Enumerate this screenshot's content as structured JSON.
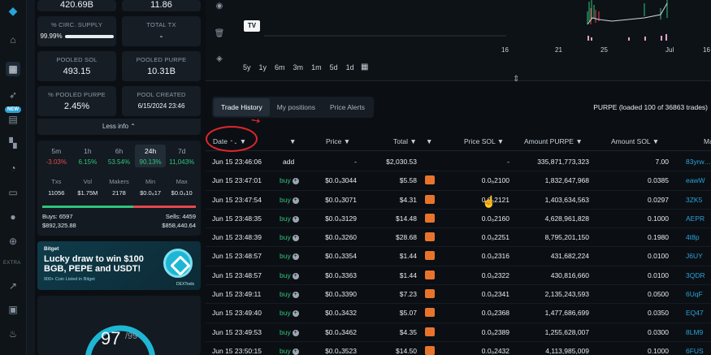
{
  "rail": {
    "new_badge": "NEW",
    "extra_label": "EXTRA",
    "icons": [
      "logo-icon",
      "home-icon",
      "dashboard-icon",
      "rocket-icon",
      "document-icon",
      "grid-icon",
      "pie-chart-icon",
      "wallet-icon",
      "user-icon",
      "plus-circle-icon",
      "chart-up-icon",
      "monitor-icon",
      "fire-icon"
    ]
  },
  "stats": {
    "top_left_value": "420.69B",
    "top_right_value": "11.86",
    "circ_label": "% CIRC. SUPPLY",
    "circ_value": "99.99%",
    "circ_fill": 0.9999,
    "total_tx_label": "TOTAL TX",
    "total_tx_value": "-",
    "pooled_sol_label": "POOLED SOL",
    "pooled_sol_value": "493.15",
    "pooled_purpe_label": "POOLED PURPE",
    "pooled_purpe_value": "10.31B",
    "pct_pooled_label": "% POOLED PURPE",
    "pct_pooled_value": "2.45%",
    "pool_created_label": "POOL CREATED",
    "pool_created_value": "6/15/2024 23:46",
    "less_info": "Less info"
  },
  "timeframes": [
    {
      "label": "5m",
      "pct": "-3.03%",
      "dir": "red"
    },
    {
      "label": "1h",
      "pct": "6.15%",
      "dir": "green"
    },
    {
      "label": "6h",
      "pct": "53.54%",
      "dir": "green"
    },
    {
      "label": "24h",
      "pct": "90.13%",
      "dir": "green"
    },
    {
      "label": "7d",
      "pct": "11,043%",
      "dir": "green"
    }
  ],
  "metrics": [
    {
      "label": "Txs",
      "value": "11056"
    },
    {
      "label": "Vol",
      "value": "$1.75M"
    },
    {
      "label": "Makers",
      "value": "2178"
    },
    {
      "label": "Min",
      "value": "$0.0₄17"
    },
    {
      "label": "Max",
      "value": "$0.0₄10"
    }
  ],
  "buys": {
    "label": "Buys: 6597",
    "amount": "$892,325.88",
    "share": 0.59
  },
  "sells": {
    "label": "Sells: 4459",
    "amount": "$858,440.64"
  },
  "ad": {
    "brand": "Bitget",
    "headline": "Lucky draw to win $100 BGB, PEPE and USDT!",
    "sub": "900+ Coin Listed in Bitget",
    "dex": "DEXTools"
  },
  "score": {
    "value": "97",
    "max": "/99",
    "fill": 0.98
  },
  "chart": {
    "ranges": [
      "5y",
      "1y",
      "6m",
      "3m",
      "1m",
      "5d",
      "1d"
    ],
    "x_ticks": [
      "16",
      "21",
      "25",
      "Jul",
      "16"
    ],
    "tv_logo": "TV"
  },
  "tabs": [
    "Trade History",
    "My positions",
    "Price Alerts"
  ],
  "loaded_text": "PURPE (loaded 100 of 36863 trades)",
  "columns": {
    "date": "Date",
    "price": "Price",
    "total": "Total",
    "price_sol": "Price SOL",
    "amount": "Amount PURPE",
    "amount_sol": "Amount SOL",
    "maker": "Ma"
  },
  "trades": [
    {
      "date": "Jun 15 23:46:06",
      "type": "add",
      "price": "-",
      "total": "$2,030.53",
      "price_sol": "-",
      "amount": "335,871,773,323",
      "sol": "7.00",
      "maker": "83yrw…"
    },
    {
      "date": "Jun 15 23:47:01",
      "type": "buy",
      "price": "$0.0₄3044",
      "total": "$5.58",
      "price_sol": "0.0₈2100",
      "amount": "1,832,647,968",
      "sol": "0.0385",
      "maker": "eawW"
    },
    {
      "date": "Jun 15 23:47:54",
      "type": "buy",
      "price": "$0.0₄3071",
      "total": "$4.31",
      "price_sol": "0.0₈2121",
      "amount": "1,403,634,563",
      "sol": "0.0297",
      "maker": "3ZK5"
    },
    {
      "date": "Jun 15 23:48:35",
      "type": "buy",
      "price": "$0.0₄3129",
      "total": "$14.48",
      "price_sol": "0.0₈2160",
      "amount": "4,628,961,828",
      "sol": "0.1000",
      "maker": "AEPR"
    },
    {
      "date": "Jun 15 23:48:39",
      "type": "buy",
      "price": "$0.0₄3260",
      "total": "$28.68",
      "price_sol": "0.0₈2251",
      "amount": "8,795,201,150",
      "sol": "0.1980",
      "maker": "4t8p"
    },
    {
      "date": "Jun 15 23:48:57",
      "type": "buy",
      "price": "$0.0₄3354",
      "total": "$1.44",
      "price_sol": "0.0₈2316",
      "amount": "431,682,224",
      "sol": "0.0100",
      "maker": "J6UY"
    },
    {
      "date": "Jun 15 23:48:57",
      "type": "buy",
      "price": "$0.0₄3363",
      "total": "$1.44",
      "price_sol": "0.0₈2322",
      "amount": "430,816,660",
      "sol": "0.0100",
      "maker": "3QDR"
    },
    {
      "date": "Jun 15 23:49:11",
      "type": "buy",
      "price": "$0.0₄3390",
      "total": "$7.23",
      "price_sol": "0.0₈2341",
      "amount": "2,135,243,593",
      "sol": "0.0500",
      "maker": "6UqF"
    },
    {
      "date": "Jun 15 23:49:40",
      "type": "buy",
      "price": "$0.0₄3432",
      "total": "$5.07",
      "price_sol": "0.0₈2368",
      "amount": "1,477,686,699",
      "sol": "0.0350",
      "maker": "EQ47"
    },
    {
      "date": "Jun 15 23:49:53",
      "type": "buy",
      "price": "$0.0₄3462",
      "total": "$4.35",
      "price_sol": "0.0₈2389",
      "amount": "1,255,628,007",
      "sol": "0.0300",
      "maker": "8LM9"
    },
    {
      "date": "Jun 15 23:50:15",
      "type": "buy",
      "price": "$0.0₄3523",
      "total": "$14.50",
      "price_sol": "0.0₈2432",
      "amount": "4,113,985,009",
      "sol": "0.1000",
      "maker": "6FUS"
    }
  ]
}
